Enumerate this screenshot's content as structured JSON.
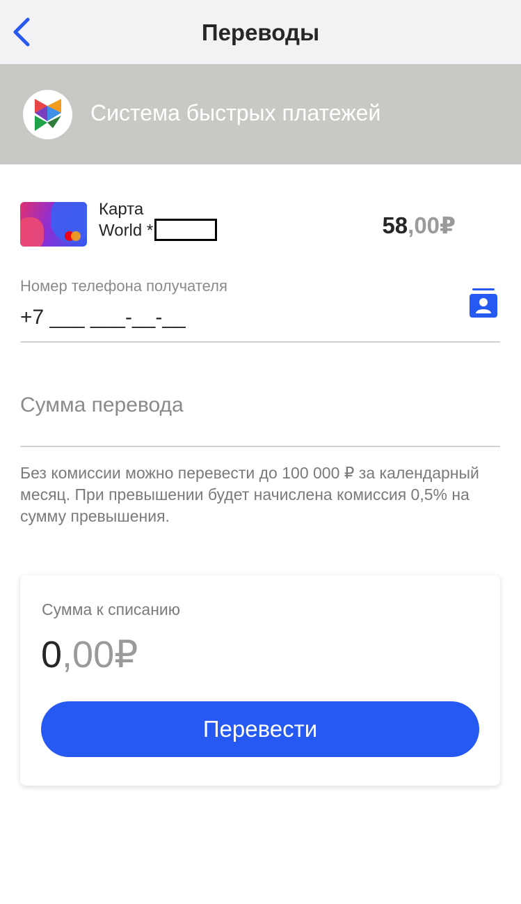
{
  "header": {
    "title": "Переводы",
    "back_icon": "chevron-left-icon"
  },
  "sbp": {
    "title": "Система быстрых платежей",
    "logo_icon": "sbp-logo-icon"
  },
  "card": {
    "name_line1": "Карта",
    "name_line2": "World *",
    "balance_int": "58",
    "balance_frac": ",00",
    "currency": "₽"
  },
  "phone": {
    "label": "Номер телефона получателя",
    "value": "+7 ___ ___-__-__",
    "contacts_icon": "contacts-icon"
  },
  "amount": {
    "placeholder": "Сумма перевода"
  },
  "note": "Без комиссии можно перевести до 100 000 ₽ за календарный месяц. При превышении будет начислена комиссия 0,5% на сумму превышения.",
  "total": {
    "label": "Сумма к списанию",
    "value_int": "0",
    "value_frac": ",00",
    "currency": "₽"
  },
  "actions": {
    "transfer_label": "Перевести"
  },
  "colors": {
    "accent": "#2659f2",
    "banner": "#c8c8c4"
  }
}
